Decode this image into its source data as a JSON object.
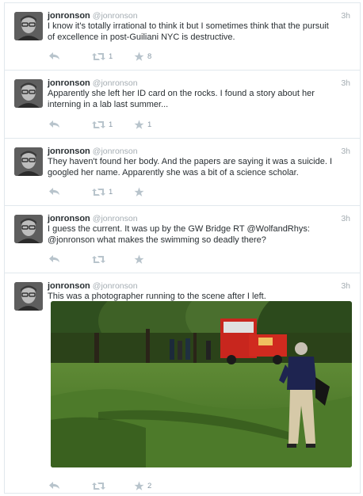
{
  "tweets": [
    {
      "name": "jonronson",
      "handle": "@jonronson",
      "time": "3h",
      "lines": [
        "I know it's totally irrational to think it but I sometimes think that the pursuit",
        "of excellence in post-Guiliani NYC is destructive."
      ],
      "retweets": "1",
      "favorites": "8"
    },
    {
      "name": "jonronson",
      "handle": "@jonronson",
      "time": "3h",
      "lines": [
        "Apparently she left her ID card on the rocks. I found a story about her",
        "interning in a lab last summer..."
      ],
      "retweets": "1",
      "favorites": "1"
    },
    {
      "name": "jonronson",
      "handle": "@jonronson",
      "time": "3h",
      "lines": [
        "They haven't found her body. And the papers are saying it was a suicide. I",
        "googled her name. Apparently she was a bit of a science scholar."
      ],
      "retweets": "1",
      "favorites": ""
    },
    {
      "name": "jonronson",
      "handle": "@jonronson",
      "time": "3h",
      "lines": [
        "I guess the current. It was up by the GW Bridge RT @WolfandRhys:",
        "@jonronson what makes the swimming so deadly there?"
      ],
      "retweets": "",
      "favorites": ""
    },
    {
      "name": "jonronson",
      "handle": "@jonronson",
      "time": "3h",
      "lines": [
        "This was a photographer running to the scene after I left."
      ],
      "retweets": "",
      "favorites": "2"
    }
  ],
  "icons": {
    "reply": "reply-icon",
    "retweet": "retweet-icon",
    "favorite": "star-icon"
  },
  "colors": {
    "text": "#292f33",
    "muted": "#a4acb2",
    "action": "#8899a6",
    "divider": "#e1e8ed"
  }
}
